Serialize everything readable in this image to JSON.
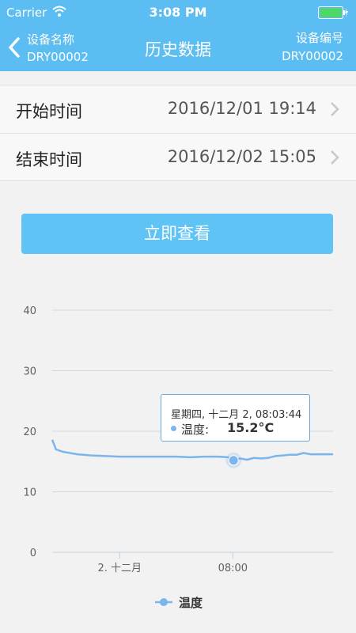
{
  "status_bar": {
    "carrier": "Carrier",
    "time": "3:08 PM"
  },
  "nav": {
    "back_line1": "设备名称",
    "back_line2": "DRY00002",
    "title": "历史数据",
    "right_line1": "设备编号",
    "right_line2": "DRY00002"
  },
  "time_range": {
    "start_label": "开始时间",
    "start_value": "2016/12/01 19:14",
    "end_label": "结束时间",
    "end_value": "2016/12/02 15:05"
  },
  "query_button": "立即查看",
  "tooltip": {
    "date": "星期四, 十二月 2, 08:03:44",
    "series_name": "温度: ",
    "value": "15.2°C"
  },
  "colors": {
    "accent": "#5bbdf1",
    "series": "#7cb5ec"
  },
  "chart_data": {
    "type": "line",
    "x_ticks": [
      "2. 十二月",
      "08:00"
    ],
    "ylim": [
      0,
      40
    ],
    "y_ticks": [
      0,
      10,
      20,
      30,
      40
    ],
    "grid": true,
    "legend_position": "bottom",
    "series": [
      {
        "name": "温度",
        "x": [
          "2016/12/01 19:14",
          "2016/12/01 19:30",
          "2016/12/01 20:00",
          "2016/12/01 21:00",
          "2016/12/01 22:00",
          "2016/12/01 23:00",
          "2016/12/02 00:00",
          "2016/12/02 01:00",
          "2016/12/02 02:00",
          "2016/12/02 03:00",
          "2016/12/02 04:00",
          "2016/12/02 05:00",
          "2016/12/02 06:00",
          "2016/12/02 07:00",
          "2016/12/02 07:40",
          "2016/12/02 08:03",
          "2016/12/02 08:30",
          "2016/12/02 09:00",
          "2016/12/02 09:30",
          "2016/12/02 10:00",
          "2016/12/02 10:30",
          "2016/12/02 11:00",
          "2016/12/02 11:30",
          "2016/12/02 12:00",
          "2016/12/02 12:30",
          "2016/12/02 13:00",
          "2016/12/02 13:30",
          "2016/12/02 14:00",
          "2016/12/02 15:05"
        ],
        "values": [
          18.6,
          17.0,
          16.6,
          16.2,
          16.0,
          15.9,
          15.8,
          15.8,
          15.8,
          15.8,
          15.8,
          15.7,
          15.8,
          15.8,
          15.7,
          15.2,
          15.5,
          15.3,
          15.6,
          15.5,
          15.6,
          15.9,
          16.0,
          16.1,
          16.1,
          16.4,
          16.2,
          16.2,
          16.2
        ]
      }
    ]
  }
}
